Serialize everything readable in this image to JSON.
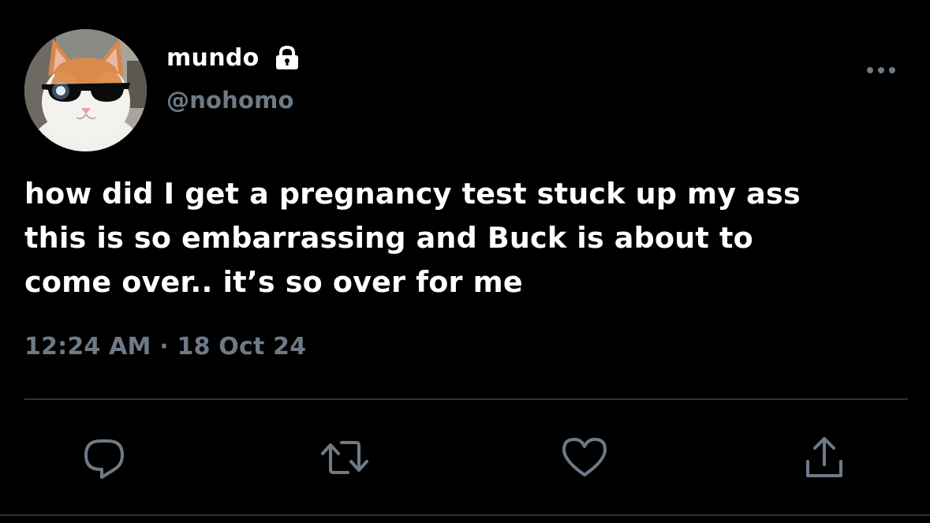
{
  "user": {
    "display_name": "mundo",
    "handle": "@nohomo",
    "protected": true
  },
  "tweet": {
    "text": "how did I get a pregnancy test stuck up my ass\nthis is so embarrassing and Buck is about to\ncome over.. it’s so over for me",
    "timestamp": "12:24 AM · 18 Oct 24"
  },
  "icons": {
    "lock": "lock-icon",
    "more": "more-icon",
    "reply": "reply-icon",
    "retweet": "retweet-icon",
    "like": "heart-icon",
    "share": "share-icon"
  },
  "colors": {
    "background": "#000000",
    "text_primary": "#ffffff",
    "text_secondary": "#6e7a86",
    "divider": "#2f3336"
  }
}
